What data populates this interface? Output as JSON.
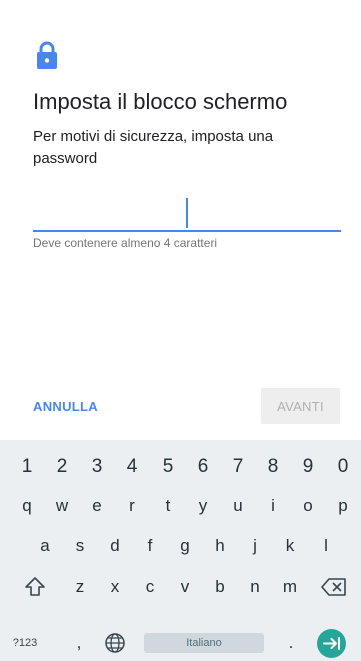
{
  "header": {
    "icon": "lock-icon",
    "title": "Imposta il blocco schermo",
    "subtitle": "Per motivi di sicurezza, imposta una password"
  },
  "password": {
    "value": "",
    "helper": "Deve contenere almeno 4 caratteri"
  },
  "actions": {
    "cancel": "ANNULLA",
    "next": "AVANTI"
  },
  "keyboard": {
    "numbers": [
      "1",
      "2",
      "3",
      "4",
      "5",
      "6",
      "7",
      "8",
      "9",
      "0"
    ],
    "row1": [
      "q",
      "w",
      "e",
      "r",
      "t",
      "y",
      "u",
      "i",
      "o",
      "p"
    ],
    "row2": [
      "a",
      "s",
      "d",
      "f",
      "g",
      "h",
      "j",
      "k",
      "l"
    ],
    "row3": [
      "z",
      "x",
      "c",
      "v",
      "b",
      "n",
      "m"
    ],
    "symbols_label": "?123",
    "comma": ",",
    "space_label": "Italiano",
    "period": ".",
    "icons": {
      "shift": "shift-icon",
      "backspace": "backspace-icon",
      "language": "globe-icon",
      "enter": "arrow-right-tab-icon"
    }
  },
  "colors": {
    "accent": "#4a86e8",
    "enter_key": "#26a69a",
    "keyboard_bg": "#eceff1"
  }
}
